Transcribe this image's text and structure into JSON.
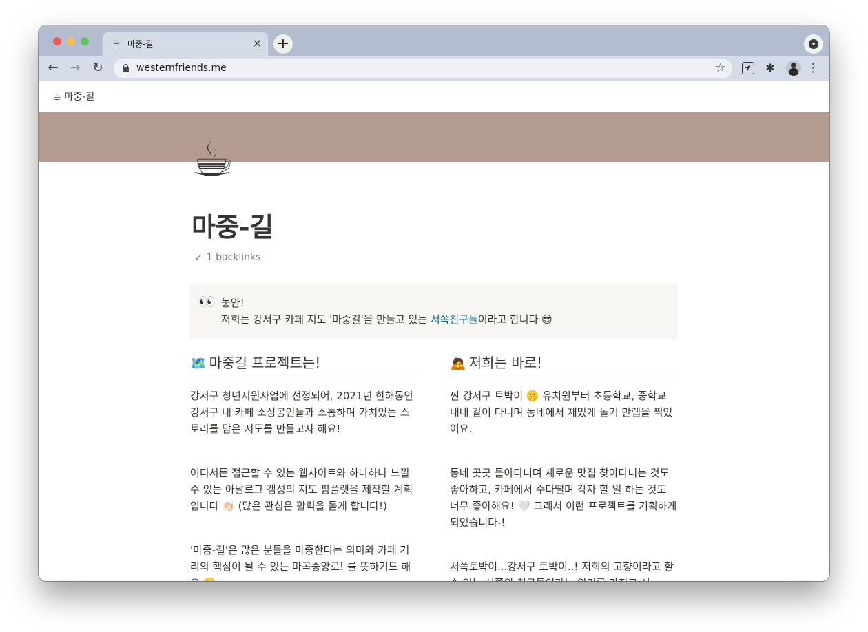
{
  "browser": {
    "tab": {
      "favicon": "☕",
      "title": "마중-길",
      "close_icon": "×"
    },
    "new_tab_icon": "+",
    "url": "westernfriends.me",
    "icons": {
      "back": "←",
      "forward": "→",
      "reload": "↻",
      "bookmark": "☆",
      "extensions": "✱",
      "menu": "⋮"
    }
  },
  "page": {
    "breadcrumb": {
      "icon": "☕",
      "label": "마중-길"
    },
    "icon": "☕",
    "cover_color": "#b39b8f",
    "title": "마중-길",
    "backlinks": {
      "icon": "↙",
      "label": "1 backlinks"
    },
    "callout": {
      "icon": "👀",
      "line1": "놓안!",
      "line2_before": "저희는 강서구 카페 지도 '마중길'을 만들고 있는 ",
      "line2_link": "서쪽친구들",
      "line2_after": "이라고 합니다 😎"
    },
    "left_column": {
      "heading_icon": "🗺️",
      "heading": "마중길 프로젝트는!",
      "paragraphs": [
        "강서구 청년지원사업에 선정되어, 2021년 한해동안 강서구 내 카페 소상공인들과 소통하며 가치있는 스토리를 담은 지도를 만들고자 해요!",
        "어디서든 접근할 수 있는 웹사이트와 하나하나 느낄 수 있는 아날로그 갬성의 지도 팜플렛을 제작할 계획입니다 👏🏻 (많은 관심은 활력을 돋게 합니다!)",
        "'마중-길'은 많은 분들을 마중한다는 의미와 카페 거리의 핵심이 될 수 있는 마곡중앙로! 를 뜻하기도 해요 🙂"
      ]
    },
    "right_column": {
      "heading_icon": "🙇",
      "heading": "저희는 바로!",
      "paragraphs": [
        "찐 강서구 토박이 🤫 유치원부터 초등학교, 중학교 내내 같이 다니며 동네에서 재밌게 놀기 만렙을 찍었어요.",
        "동네 곳곳 돌아다니며 새로운 맛집 찾아다니는 것도 좋아하고, 카페에서 수다떨며 각자 할 일 하는 것도 너무 좋아해요! 🤍 그래서 이런 프로젝트를 기획하게 되었습니다-!",
        "서쪽토박이...강서구 토박이..! 저희의 고향이라고 할 수 있는 서쪽의 친구들이라는 의미를 가지고 서"
      ]
    }
  }
}
